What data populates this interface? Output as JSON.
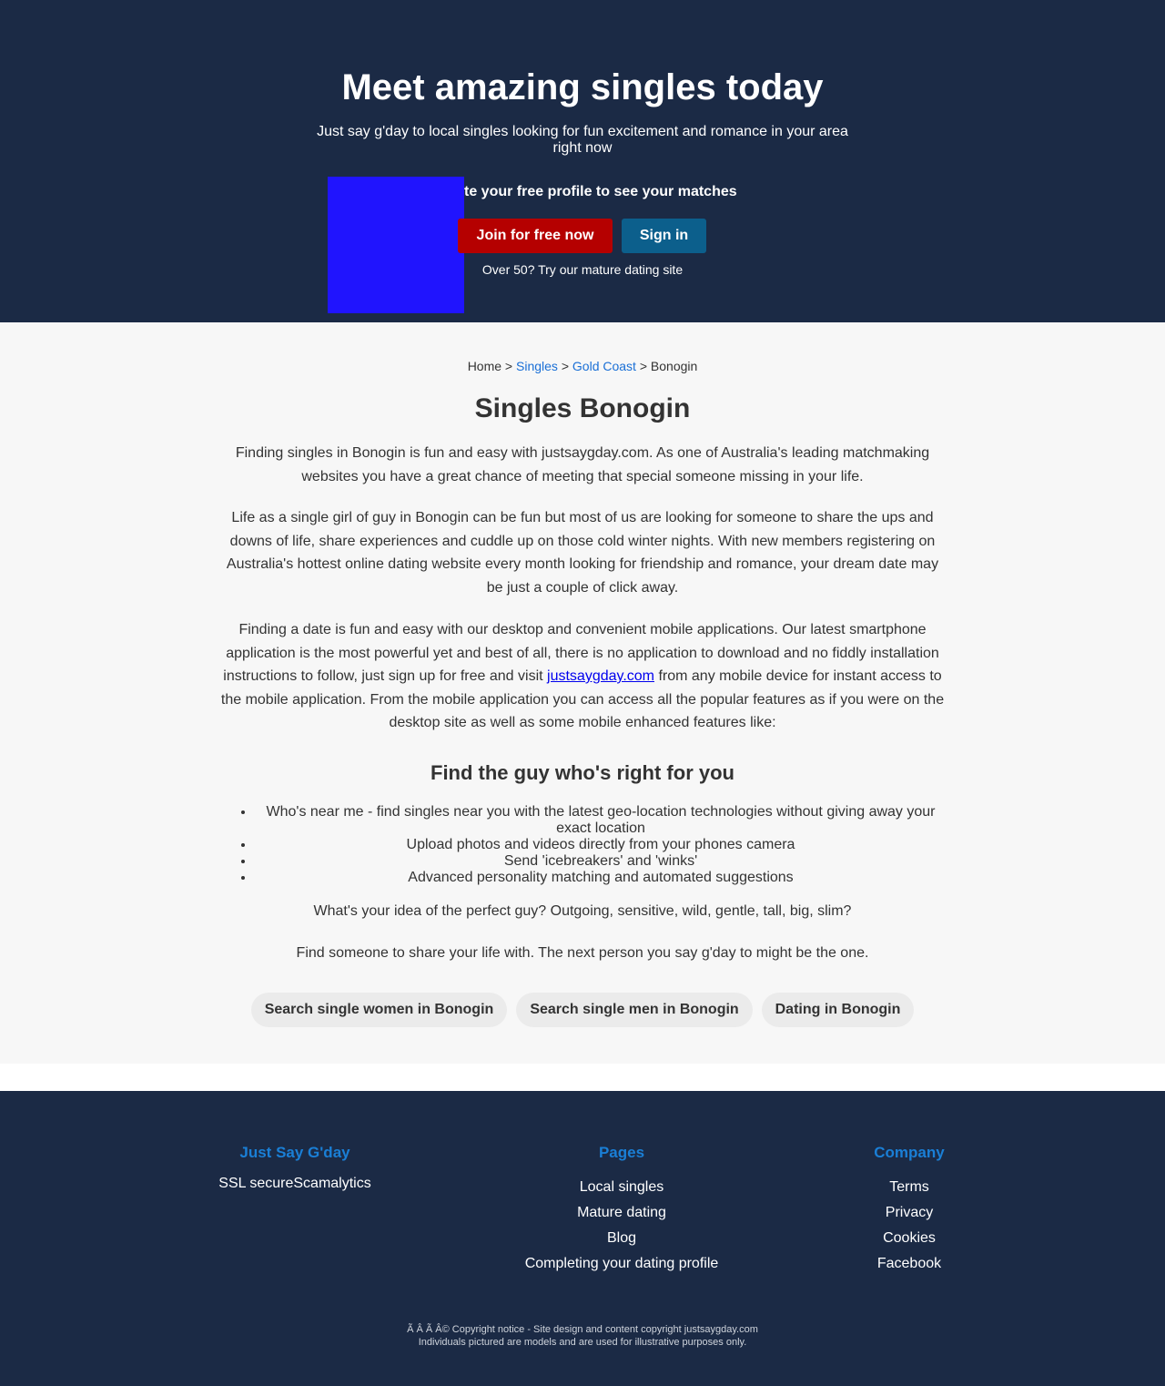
{
  "hero": {
    "title": "Meet amazing singles today",
    "subtitle": "Just say g'day to local singles looking for fun excitement and romance in your area right now",
    "cta_text": "te your free profile to see your matches",
    "join_label": "Join for free now",
    "signin_label": "Sign in",
    "mature_text": "Over 50? Try our mature dating site",
    "image_color": "#2014fe"
  },
  "breadcrumb": {
    "home": "Home",
    "sep1": " > ",
    "singles": "Singles",
    "sep2": " > ",
    "region": "Gold Coast",
    "sep3": " > ",
    "current": "Bonogin"
  },
  "main": {
    "title": "Singles Bonogin",
    "p1": "Finding singles in Bonogin is fun and easy with justsaygday.com. As one of Australia's leading matchmaking websites you have a great chance of meeting that special someone missing in your life.",
    "p2": "Life as a single girl of guy in Bonogin can be fun but most of us are looking for someone to share the ups and downs of life, share experiences and cuddle up on those cold winter nights. With new members registering on Australia's hottest online dating website every month looking for friendship and romance, your dream date may be just a couple of click away.",
    "p3_before": "Finding a date is fun and easy with our desktop and convenient mobile applications. Our latest smartphone application is the most powerful yet and best of all, there is no application to download and no fiddly installation instructions to follow, just sign up for free and visit ",
    "p3_link": "justsaygday.com",
    "p3_after": " from any mobile device for instant access to the mobile application. From the mobile application you can access all the popular features as if you were on the desktop site as well as some mobile enhanced features like:",
    "subheading": "Find the guy who's right for you",
    "features": [
      "Who's near me - find singles near you with the latest geo-location technologies without giving away your exact location",
      "Upload photos and videos directly from your phones camera",
      "Send 'icebreakers' and 'winks'",
      "Advanced personality matching and automated suggestions"
    ],
    "q1": "What's your idea of the perfect guy? Outgoing, sensitive, wild, gentle, tall, big, slim?",
    "q2": "Find someone to share your life with. The next person you say g'day to might be the one.",
    "pills": [
      "Search single women in Bonogin",
      "Search single men in Bonogin",
      "Dating in Bonogin"
    ]
  },
  "footer": {
    "col1_title": "Just Say G'day",
    "col1_text": "SSL secureScamalytics",
    "col2_title": "Pages",
    "col2_links": [
      "Local singles",
      "Mature dating",
      "Blog",
      "Completing your dating profile"
    ],
    "col3_title": "Company",
    "col3_links": [
      "Terms",
      "Privacy",
      "Cookies",
      "Facebook"
    ],
    "copyright_line1": "Ã   Â   Ã   Â© Copyright notice - Site design and content copyright justsaygday.com",
    "copyright_line2": "Individuals pictured are models and are used for illustrative purposes only.",
    "heading_color": "#1a7fd6",
    "background": "#1b2a45"
  }
}
